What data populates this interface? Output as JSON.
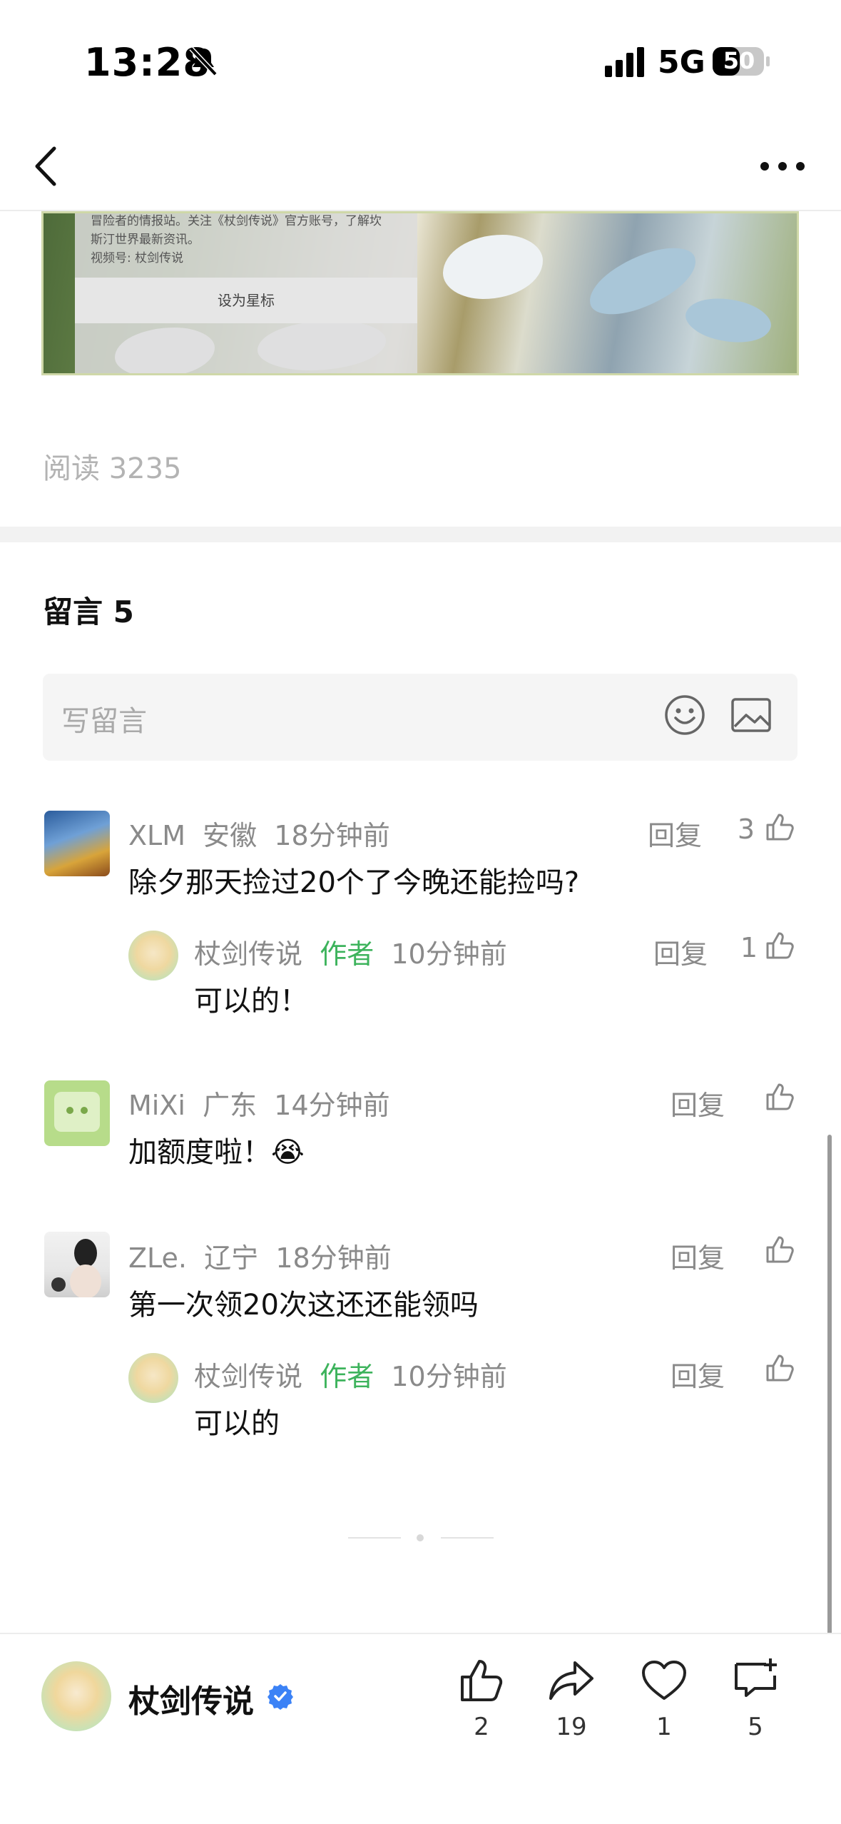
{
  "status_bar": {
    "time": "13:28",
    "network": "5G",
    "battery": "50"
  },
  "article": {
    "image_overlay_lines": [
      "冒险者的情报站。关注《杖剑传说》官方账号，了解坎",
      "斯汀世界最新资讯。",
      "视频号: 杖剑传说"
    ],
    "set_star_label": "设为星标",
    "read_label": "阅读 3235"
  },
  "comments_section": {
    "title": "留言 5",
    "input_placeholder": "写留言",
    "comments": [
      {
        "user": "XLM",
        "location": "安徽",
        "time": "18分钟前",
        "text": "除夕那天捡过20个了今晚还能捡吗?",
        "reply_label": "回复",
        "likes": "3",
        "reply": {
          "user": "杖剑传说",
          "badge": "作者",
          "time": "10分钟前",
          "text": "可以的！",
          "reply_label": "回复",
          "likes": "1"
        }
      },
      {
        "user": "MiXi",
        "location": "广东",
        "time": "14分钟前",
        "text": "加额度啦！😭",
        "reply_label": "回复",
        "likes": ""
      },
      {
        "user": "ZLe.",
        "location": "辽宁",
        "time": "18分钟前",
        "text": "第一次领20次这还还能领吗",
        "reply_label": "回复",
        "likes": "",
        "reply": {
          "user": "杖剑传说",
          "badge": "作者",
          "time": "10分钟前",
          "text": "可以的",
          "reply_label": "回复",
          "likes": ""
        }
      }
    ]
  },
  "bottom_bar": {
    "account_name": "杖剑传说",
    "actions": [
      {
        "icon": "thumbs-up-icon",
        "count": "2"
      },
      {
        "icon": "share-icon",
        "count": "19"
      },
      {
        "icon": "heart-icon",
        "count": "1"
      },
      {
        "icon": "comment-add-icon",
        "count": "5"
      }
    ]
  },
  "colors": {
    "author_green": "#3db35c",
    "verified_blue": "#3b82f6",
    "muted_gray": "#8a8a8a"
  }
}
